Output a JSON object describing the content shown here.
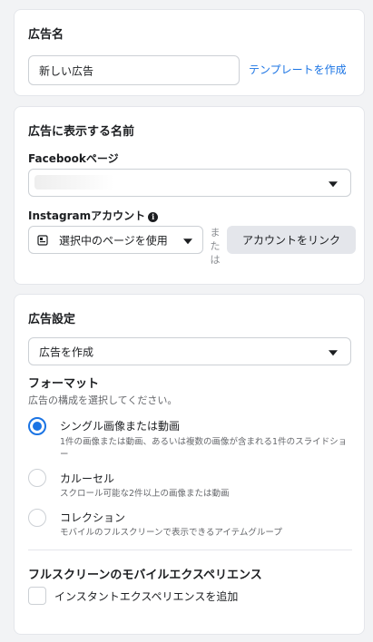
{
  "ad_name": {
    "title": "広告名",
    "input_value": "新しい広告",
    "template_link": "テンプレートを作成"
  },
  "identity": {
    "title": "広告に表示する名前",
    "facebook_label": "Facebookページ",
    "facebook_value": "",
    "instagram_label": "Instagramアカウント",
    "instagram_value": "選択中のページを使用",
    "or_text": "または",
    "link_account_button": "アカウントをリンク"
  },
  "ad_setup": {
    "title": "広告設定",
    "create_select": "広告を作成",
    "format_label": "フォーマット",
    "format_hint": "広告の構成を選択してください。",
    "options": [
      {
        "title": "シングル画像または動画",
        "desc": "1件の画像または動画、あるいは複数の画像が含まれる1件のスライドショー",
        "selected": true
      },
      {
        "title": "カルーセル",
        "desc": "スクロール可能な2件以上の画像または動画",
        "selected": false
      },
      {
        "title": "コレクション",
        "desc": "モバイルのフルスクリーンで表示できるアイテムグループ",
        "selected": false
      }
    ],
    "fullscreen_label": "フルスクリーンのモバイルエクスペリエンス",
    "instant_experience_label": "インスタントエクスペリエンスを追加"
  },
  "colors": {
    "accent": "#1b74e4",
    "background": "#f2f3f5"
  }
}
